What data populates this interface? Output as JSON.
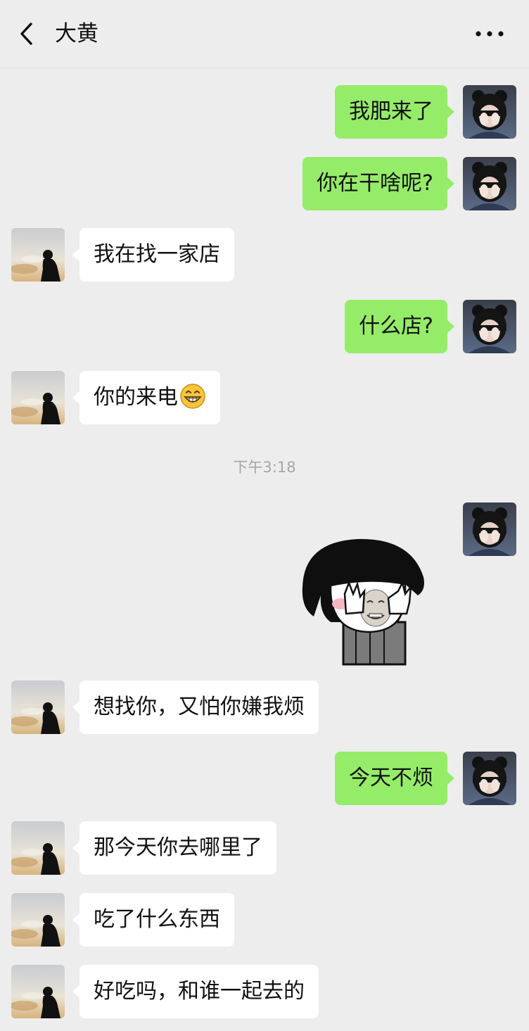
{
  "header": {
    "title": "大黄",
    "back_icon": "chevron-left-icon",
    "more_icon": "more-horizontal-icon"
  },
  "messages": [
    {
      "sender": "me",
      "text": "我肥来了"
    },
    {
      "sender": "me",
      "text": "你在干啥呢?"
    },
    {
      "sender": "them",
      "text": "我在找一家店"
    },
    {
      "sender": "me",
      "text": "什么店?"
    },
    {
      "sender": "them",
      "text": "你的来电",
      "emoji": "grinning-face-icon"
    },
    {
      "sender": "me",
      "type": "sticker",
      "sticker": "face-covering-sticker"
    },
    {
      "sender": "them",
      "text": "想找你，又怕你嫌我烦"
    },
    {
      "sender": "me",
      "text": "今天不烦"
    },
    {
      "sender": "them",
      "text": "那今天你去哪里了"
    },
    {
      "sender": "them",
      "text": "吃了什么东西"
    },
    {
      "sender": "them",
      "text": "好吃吗，和谁一起去的"
    }
  ],
  "timestamp": "下午3:18",
  "colors": {
    "background": "#ededed",
    "my_bubble": "#95ec69",
    "their_bubble": "#ffffff"
  }
}
